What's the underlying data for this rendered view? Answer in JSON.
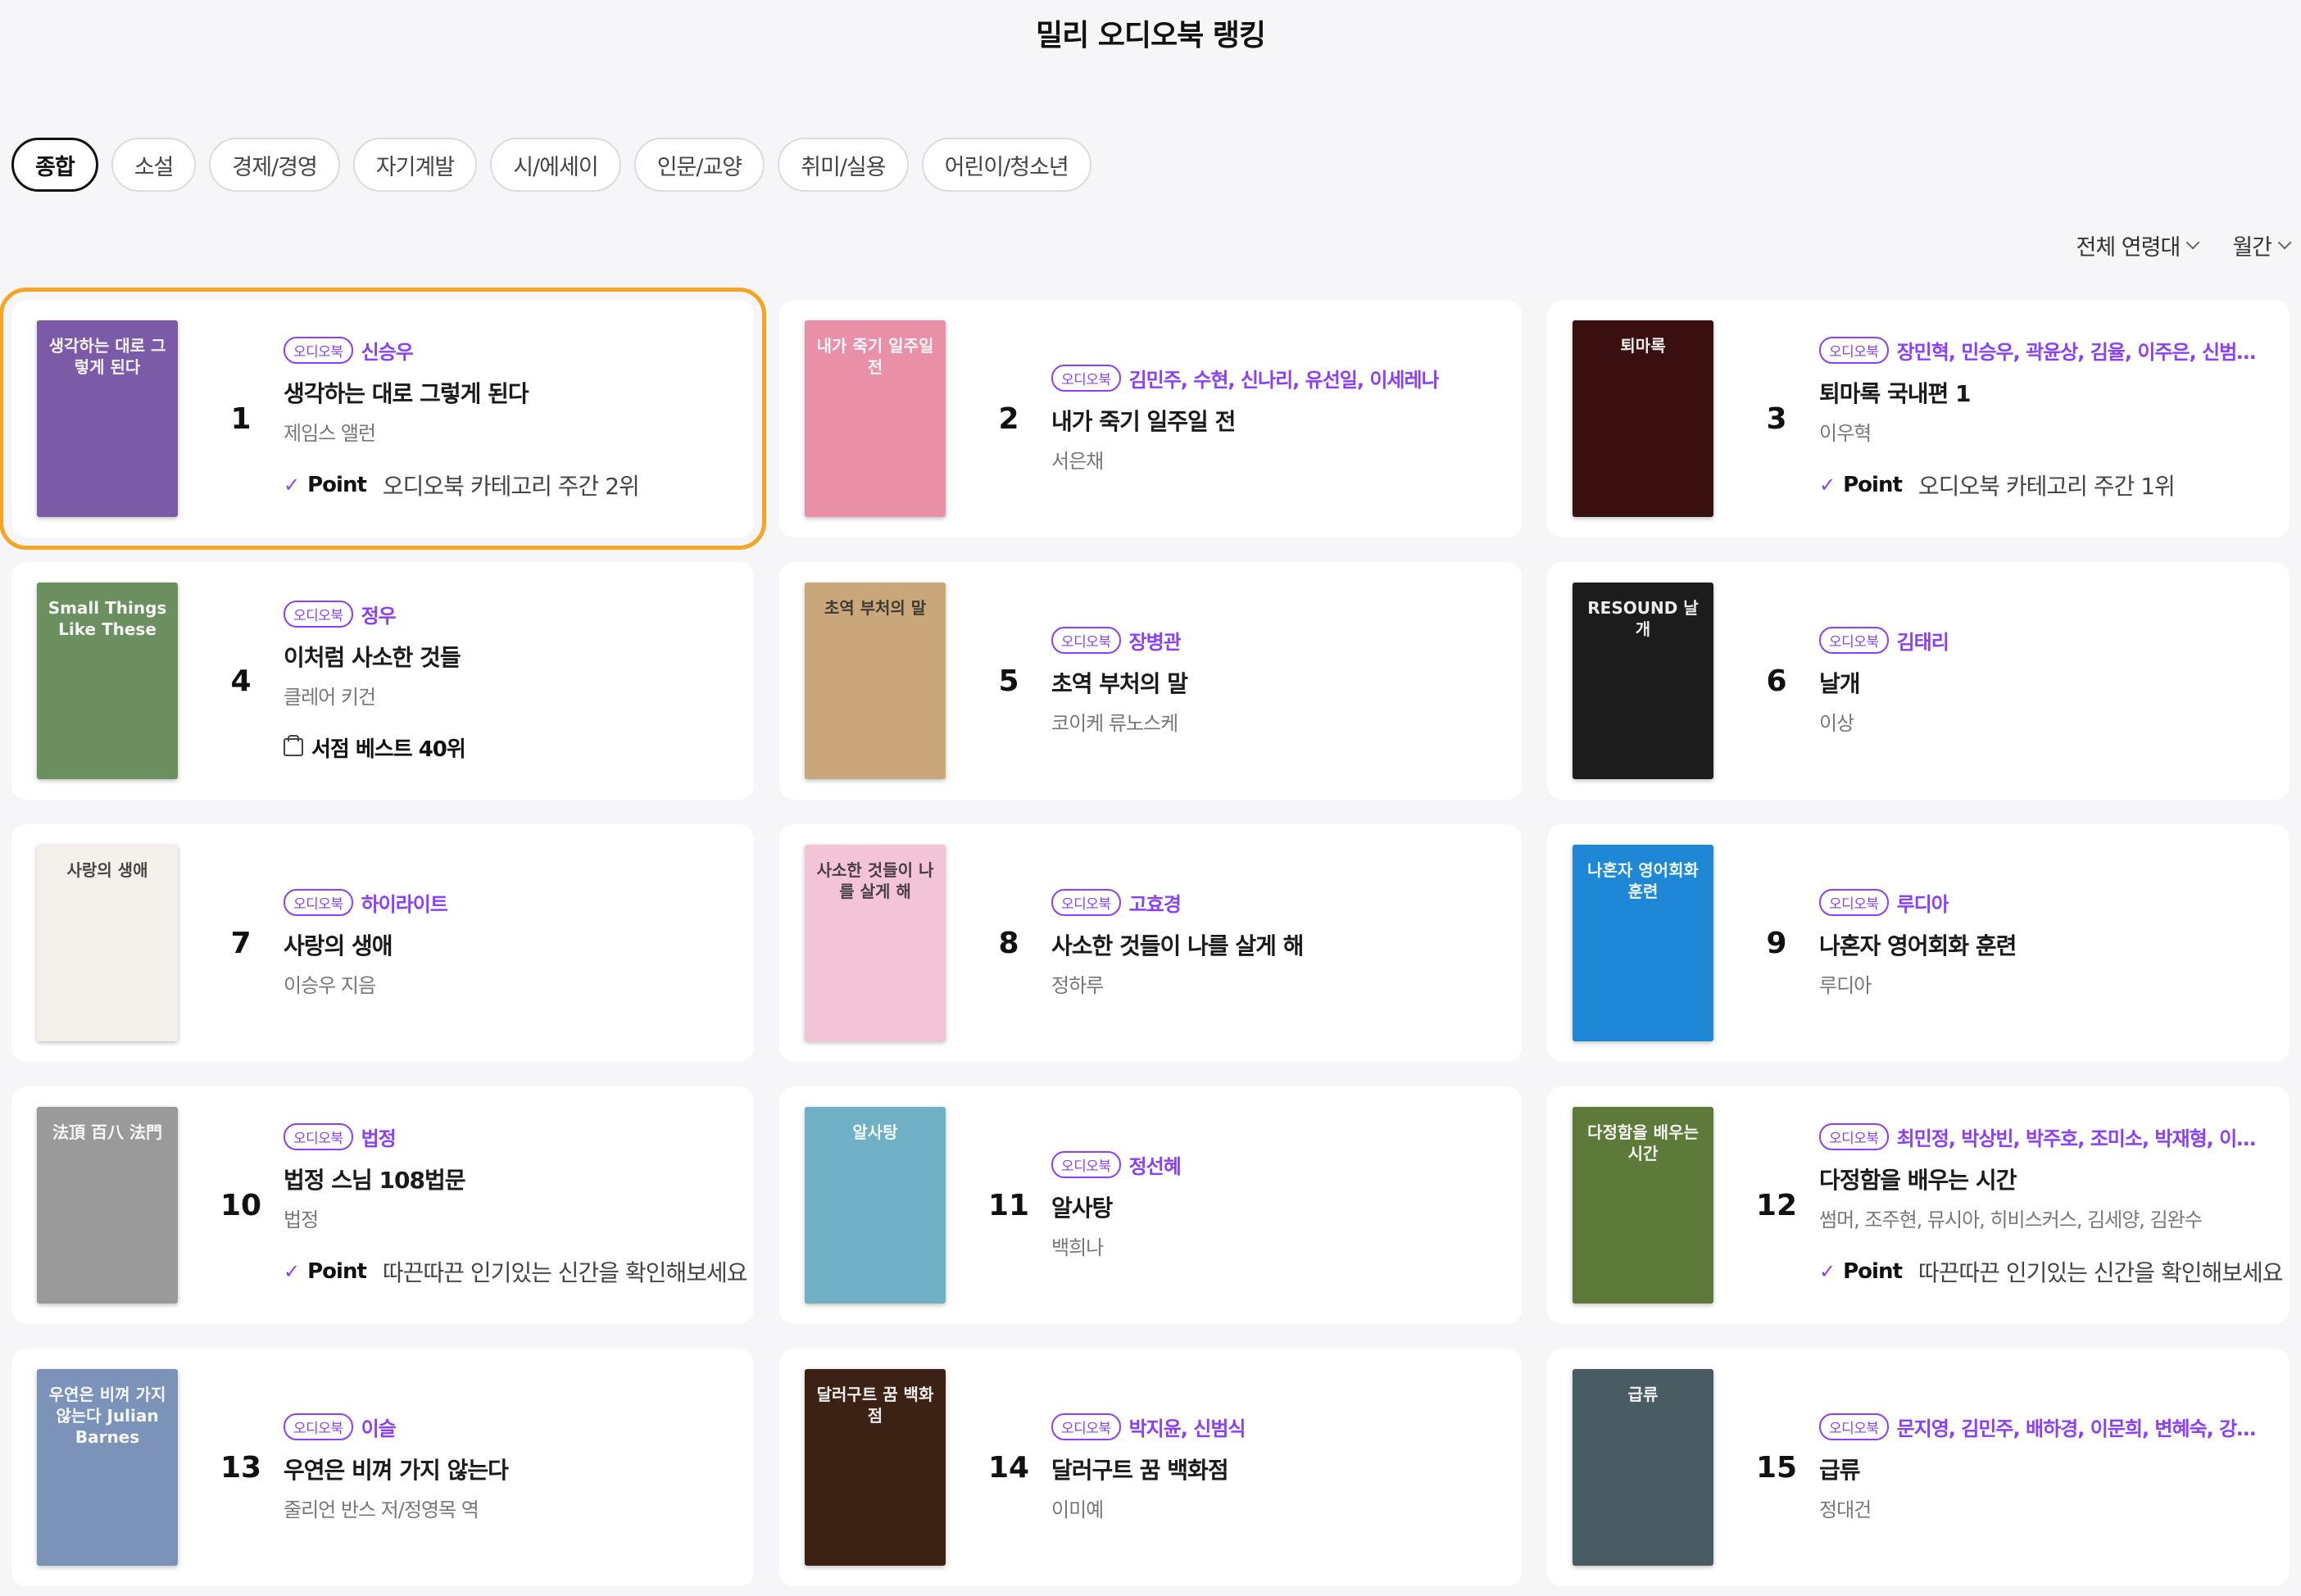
{
  "page_title": "밀리 오디오북 랭킹",
  "tabs": [
    "종합",
    "소설",
    "경제/경영",
    "자기계발",
    "시/에세이",
    "인문/교양",
    "취미/실용",
    "어린이/청소년"
  ],
  "active_tab": "종합",
  "filters": {
    "age": "전체 연령대",
    "period": "월간"
  },
  "badge_label": "오디오북",
  "point_label": "Point",
  "books": [
    {
      "rank": "1",
      "narrator": "신승우",
      "title": "생각하는 대로 그렇게 된다",
      "author": "제임스 앨런",
      "note_type": "point",
      "note": "오디오북 카테고리 주간 2위",
      "cover_text": "생각하는 대로 그렇게 된다",
      "cover_color": "#7b5aa8"
    },
    {
      "rank": "2",
      "narrator": "김민주, 수현, 신나리, 유선일, 이세레나",
      "title": "내가 죽기 일주일 전",
      "author": "서은채",
      "note_type": "",
      "note": "",
      "cover_text": "내가 죽기 일주일 전",
      "cover_color": "#e98fa8"
    },
    {
      "rank": "3",
      "narrator": "장민혁, 민승우, 곽윤상, 김율, 이주은, 신범식, …",
      "title": "퇴마록 국내편 1",
      "author": "이우혁",
      "note_type": "point",
      "note": "오디오북 카테고리 주간 1위",
      "cover_text": "퇴마록",
      "cover_color": "#3a0f0f"
    },
    {
      "rank": "4",
      "narrator": "정우",
      "title": "이처럼 사소한 것들",
      "author": "클레어 키건",
      "note_type": "store",
      "note": "서점 베스트 40위",
      "cover_text": "Small Things Like These",
      "cover_color": "#6b8f5e"
    },
    {
      "rank": "5",
      "narrator": "장병관",
      "title": "초역 부처의 말",
      "author": "코이케 류노스케",
      "note_type": "",
      "note": "",
      "cover_text": "초역 부처의 말",
      "cover_color": "#c9a77b"
    },
    {
      "rank": "6",
      "narrator": "김태리",
      "title": "날개",
      "author": "이상",
      "note_type": "",
      "note": "",
      "cover_text": "RESOUND 날개",
      "cover_color": "#1c1c1c"
    },
    {
      "rank": "7",
      "narrator": "하이라이트",
      "title": "사랑의 생애",
      "author": "이승우 지음",
      "note_type": "",
      "note": "",
      "cover_text": "사랑의 생애",
      "cover_color": "#f4f1ec"
    },
    {
      "rank": "8",
      "narrator": "고효경",
      "title": "사소한 것들이 나를 살게 해",
      "author": "정하루",
      "note_type": "",
      "note": "",
      "cover_text": "사소한 것들이 나를 살게 해",
      "cover_color": "#f3c3d6"
    },
    {
      "rank": "9",
      "narrator": "루디아",
      "title": "나혼자 영어회화 훈련",
      "author": "루디아",
      "note_type": "",
      "note": "",
      "cover_text": "나혼자 영어회화 훈련",
      "cover_color": "#1e88d6"
    },
    {
      "rank": "10",
      "narrator": "법정",
      "title": "법정 스님 108법문",
      "author": "법정",
      "note_type": "point",
      "note": "따끈따끈 인기있는 신간을 확인해보세요",
      "cover_text": "法頂 百八 法門",
      "cover_color": "#9a9a9a"
    },
    {
      "rank": "11",
      "narrator": "정선혜",
      "title": "알사탕",
      "author": "백희나",
      "note_type": "",
      "note": "",
      "cover_text": "알사탕",
      "cover_color": "#6fb0c4"
    },
    {
      "rank": "12",
      "narrator": "최민정, 박상빈, 박주호, 조미소, 박재형, 이상원…",
      "title": "다정함을 배우는 시간",
      "author": "썸머, 조주현, 뮤시아, 히비스커스, 김세양, 김완수",
      "note_type": "point",
      "note": "따끈따끈 인기있는 신간을 확인해보세요",
      "cover_text": "다정함을 배우는 시간",
      "cover_color": "#5e7a3a"
    },
    {
      "rank": "13",
      "narrator": "이슬",
      "title": "우연은 비껴 가지 않는다",
      "author": "줄리언 반스 저/정영목 역",
      "note_type": "",
      "note": "",
      "cover_text": "우연은 비껴 가지 않는다 Julian Barnes",
      "cover_color": "#7b93b8"
    },
    {
      "rank": "14",
      "narrator": "박지윤, 신범식",
      "title": "달러구트 꿈 백화점",
      "author": "이미예",
      "note_type": "",
      "note": "",
      "cover_text": "달러구트 꿈 백화점",
      "cover_color": "#3b2215"
    },
    {
      "rank": "15",
      "narrator": "문지영, 김민주, 배하경, 이문희, 변혜숙, 강용석…",
      "title": "급류",
      "author": "정대건",
      "note_type": "",
      "note": "",
      "cover_text": "급류",
      "cover_color": "#4a5c63"
    }
  ]
}
